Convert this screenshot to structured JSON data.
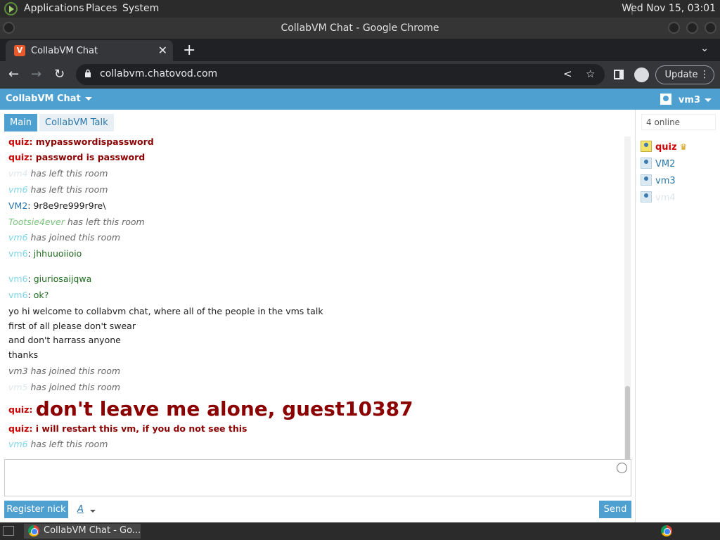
{
  "panel": {
    "applications": "Applications",
    "places": "Places",
    "system": "System",
    "clock": "Wed Nov 15, 03:01"
  },
  "window": {
    "title": "CollabVM Chat - Google Chrome"
  },
  "browser": {
    "tab_title": "CollabVM Chat",
    "url": "collabvm.chatovod.com",
    "update_label": "Update"
  },
  "app": {
    "brand": "CollabVM Chat",
    "current_user": "vm3",
    "tabs": [
      "Main",
      "CollabVM Talk"
    ],
    "messages": [
      {
        "nick": "quiz",
        "sep": ": ",
        "text": "mypasswordispassword"
      },
      {
        "nick": "quiz",
        "sep": ": ",
        "text": "password is password"
      },
      {
        "nick": "vm4",
        "text": " has left this room"
      },
      {
        "nick": "vm6",
        "text": " has left this room"
      },
      {
        "nick": "VM2",
        "sep": ": ",
        "text": "9r8e9re999r9re\\"
      },
      {
        "nick": "Tootsie4ever",
        "text": " has left this room"
      },
      {
        "nick": "vm6",
        "text": " has joined this room"
      },
      {
        "nick": "vm6",
        "sep": ": ",
        "text": "jhhuuoiioio"
      },
      {
        "nick": "vm6",
        "sep": ": ",
        "text": "giuriosaijqwa"
      },
      {
        "nick": "vm6",
        "sep": ": ",
        "text": "ok?"
      },
      {
        "text": "yo hi welcome to collabvm chat, where all of the people in the vms talk"
      },
      {
        "text": "first of all please don't swear"
      },
      {
        "text": "and don't harrass anyone"
      },
      {
        "text": "thanks"
      },
      {
        "nick": "vm3",
        "text": " has joined this room"
      },
      {
        "nick": "vm5",
        "text": " has joined this room"
      },
      {
        "nick": "quiz",
        "sep": ": ",
        "text": "don't leave me alone, guest10387"
      },
      {
        "nick": "quiz",
        "sep": ": ",
        "text": "i will restart this vm, if you do not see this"
      },
      {
        "nick": "vm6",
        "text": " has left this room"
      }
    ],
    "online_label": "4 online",
    "users": [
      "quiz",
      "VM2",
      "vm3",
      "vm4"
    ],
    "register_label": "Register nick",
    "format_label": "A",
    "send_label": "Send"
  },
  "taskbar": {
    "item": "CollabVM Chat - Go..."
  },
  "colors": {
    "accent": "#4ea0d0",
    "admin_nick": "#cc0000"
  }
}
